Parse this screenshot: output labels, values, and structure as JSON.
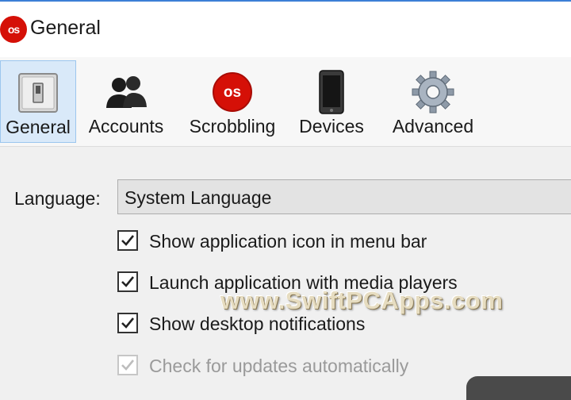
{
  "window": {
    "title": "General",
    "logo_text": "os",
    "accent_color": "#3c7fd6",
    "brand_color": "#d51007"
  },
  "toolbar": {
    "tabs": [
      {
        "label": "General",
        "icon": "light-switch-icon",
        "selected": true
      },
      {
        "label": "Accounts",
        "icon": "users-icon",
        "selected": false
      },
      {
        "label": "Scrobbling",
        "icon": "lastfm-logo-icon",
        "selected": false
      },
      {
        "label": "Devices",
        "icon": "phone-icon",
        "selected": false
      },
      {
        "label": "Advanced",
        "icon": "gear-icon",
        "selected": false
      }
    ],
    "scrobbling_icon_text": "os"
  },
  "general": {
    "language_label": "Language:",
    "language_value": "System Language",
    "options": [
      {
        "label": "Show application icon in menu bar",
        "checked": true,
        "enabled": true
      },
      {
        "label": "Launch application with media players",
        "checked": true,
        "enabled": true
      },
      {
        "label": "Show desktop notifications",
        "checked": true,
        "enabled": true
      },
      {
        "label": "Check for updates automatically",
        "checked": true,
        "enabled": false
      }
    ]
  },
  "watermark": {
    "text": "www.SwiftPCApps.com"
  }
}
